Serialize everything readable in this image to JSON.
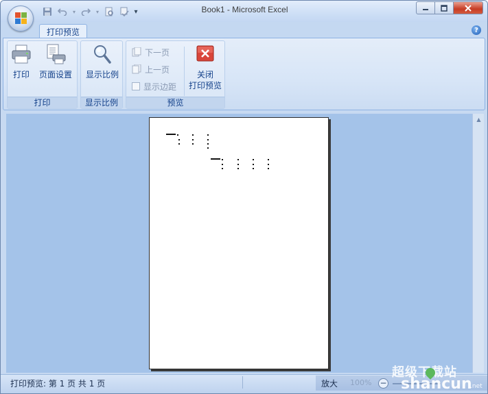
{
  "window": {
    "title": "Book1 - Microsoft Excel"
  },
  "qat": {
    "icons": [
      "save-icon",
      "undo-icon",
      "redo-icon",
      "print-preview-icon",
      "spell-check-icon",
      "customize-qat-icon"
    ]
  },
  "tabs": {
    "active": "打印预览"
  },
  "ribbon": {
    "groups": {
      "print": {
        "label": "打印",
        "print_btn": "打印",
        "page_setup_btn": "页面设置"
      },
      "zoom": {
        "label": "显示比例",
        "zoom_btn": "显示比例"
      },
      "preview": {
        "label": "预览",
        "next_page": "下一页",
        "prev_page": "上一页",
        "show_margins": "显示边距",
        "close_line1": "关闭",
        "close_line2": "打印预览"
      }
    }
  },
  "statusbar": {
    "text": "打印预览: 第 1 页 共 1 页",
    "zoom_in": "放大",
    "zoom_pct": "100%"
  },
  "watermark": {
    "cn": "超级下载站",
    "en": "shancun",
    "net": ".net"
  },
  "colors": {
    "ribbon_bg": "#dce8f7",
    "preview_bg": "#a4c3e9",
    "close_red": "#c63c25",
    "text_blue": "#15428b"
  }
}
